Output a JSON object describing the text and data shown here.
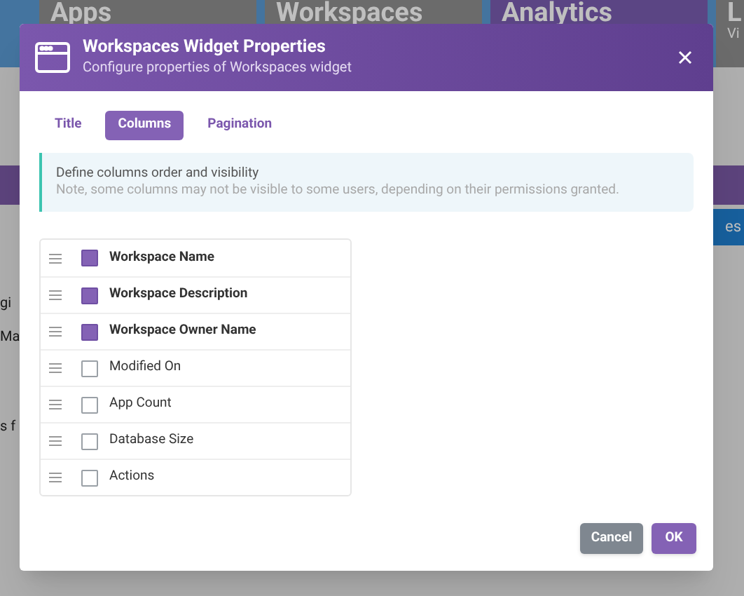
{
  "background": {
    "tiles": [
      {
        "label": "Apps",
        "selected": false
      },
      {
        "label": "Workspaces",
        "selected": false
      },
      {
        "label": "Analytics",
        "selected": true
      },
      {
        "label": "L",
        "selected": false,
        "sub": "Vi"
      }
    ],
    "left_texts": [
      "gi",
      "Ma",
      "s f"
    ],
    "right_button": "es"
  },
  "dialog": {
    "title": "Workspaces Widget Properties",
    "subtitle": "Configure properties of Workspaces widget",
    "tabs": [
      {
        "label": "Title",
        "selected": false
      },
      {
        "label": "Columns",
        "selected": true
      },
      {
        "label": "Pagination",
        "selected": false
      }
    ],
    "info": {
      "heading": "Define columns order and visibility",
      "note": "Note, some columns may not be visible to some users, depending on their permissions granted."
    },
    "columns": [
      {
        "label": "Workspace Name",
        "checked": true
      },
      {
        "label": "Workspace Description",
        "checked": true
      },
      {
        "label": "Workspace Owner Name",
        "checked": true
      },
      {
        "label": "Modified On",
        "checked": false
      },
      {
        "label": "App Count",
        "checked": false
      },
      {
        "label": "Database Size",
        "checked": false
      },
      {
        "label": "Actions",
        "checked": false
      }
    ],
    "buttons": [
      {
        "label": "Cancel",
        "kind": "secondary"
      },
      {
        "label": "OK",
        "kind": "primary"
      }
    ]
  }
}
